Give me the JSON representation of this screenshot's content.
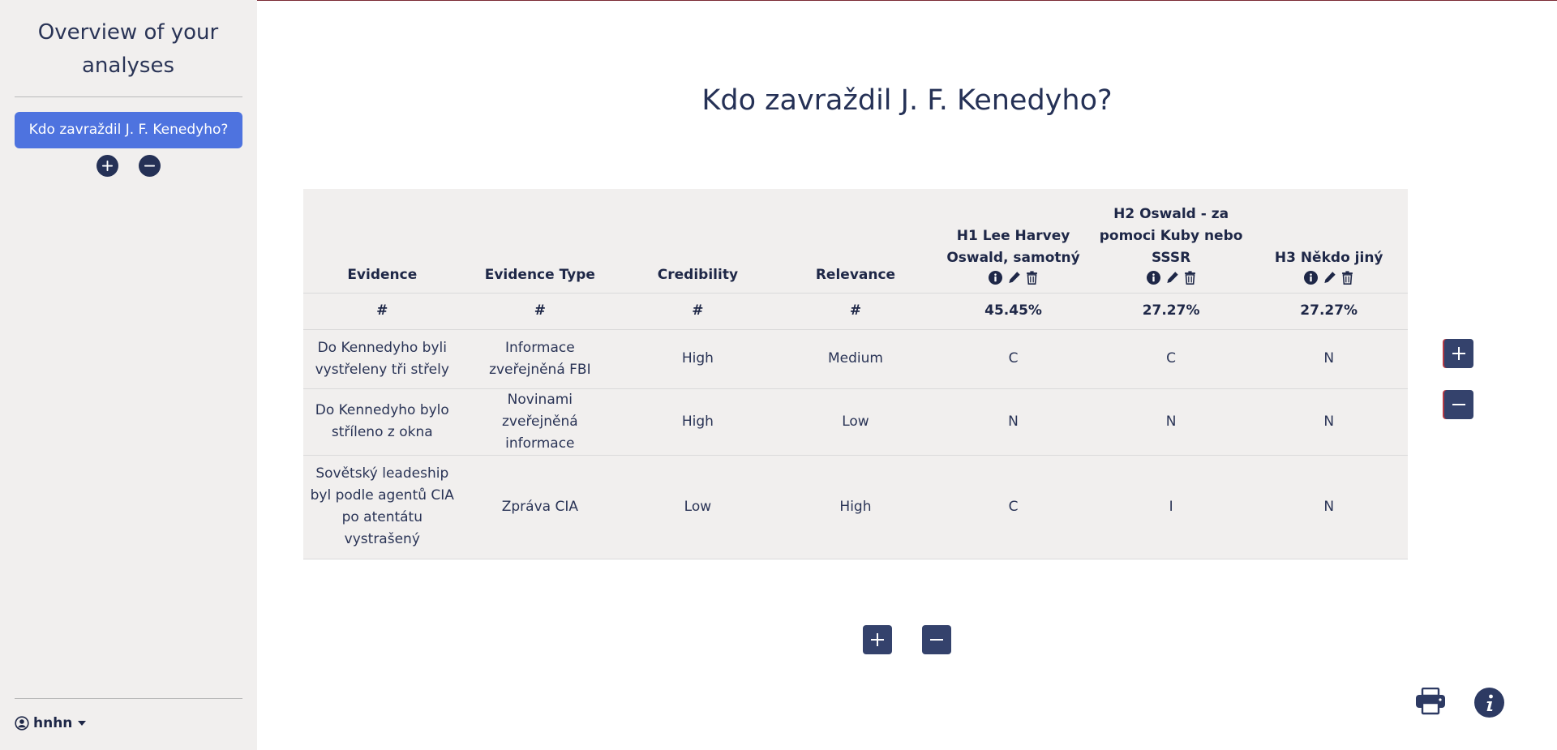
{
  "sidebar": {
    "title": "Overview of your analyses",
    "analyses": [
      {
        "label": "Kdo zavraždil J. F. Kenedyho?"
      }
    ],
    "user": "hnhn"
  },
  "analysis": {
    "title": "Kdo zavraždil J. F. Kenedyho?",
    "columns": {
      "evidence": "Evidence",
      "evidence_type": "Evidence Type",
      "credibility": "Credibility",
      "relevance": "Relevance"
    },
    "hypotheses": [
      {
        "label": "H1 Lee Harvey Oswald, samotný",
        "score": "45.45%"
      },
      {
        "label": "H2 Oswald - za pomoci Kuby nebo SSSR",
        "score": "27.27%"
      },
      {
        "label": "H3 Někdo jiný",
        "score": "27.27%"
      }
    ],
    "score_placeholder": "#",
    "rows": [
      {
        "evidence": "Do Kennedyho byli vystřeleny tři střely",
        "type": "Informace zveřejněná FBI",
        "credibility": "High",
        "relevance": "Medium",
        "h1": "C",
        "h2": "C",
        "h3": "N"
      },
      {
        "evidence": "Do Kennedyho bylo stříleno z okna",
        "type": "Novinami zveřejněná informace",
        "credibility": "High",
        "relevance": "Low",
        "h1": "N",
        "h2": "N",
        "h3": "N"
      },
      {
        "evidence": "Sovětský leadeship byl podle agentů CIA po atentátu vystrašený",
        "type": "Zpráva CIA",
        "credibility": "Low",
        "relevance": "High",
        "h1": "C",
        "h2": "I",
        "h3": "N"
      }
    ]
  },
  "icons": {
    "add": "plus-icon",
    "remove": "minus-icon",
    "info": "info-icon",
    "edit": "pencil-icon",
    "delete": "trash-icon",
    "print": "printer-icon",
    "user": "user-circle-icon"
  },
  "colors": {
    "accent": "#4e73df",
    "dark_button": "#34426c",
    "sidebar_bg": "#f1efee",
    "text": "#2a3456"
  }
}
